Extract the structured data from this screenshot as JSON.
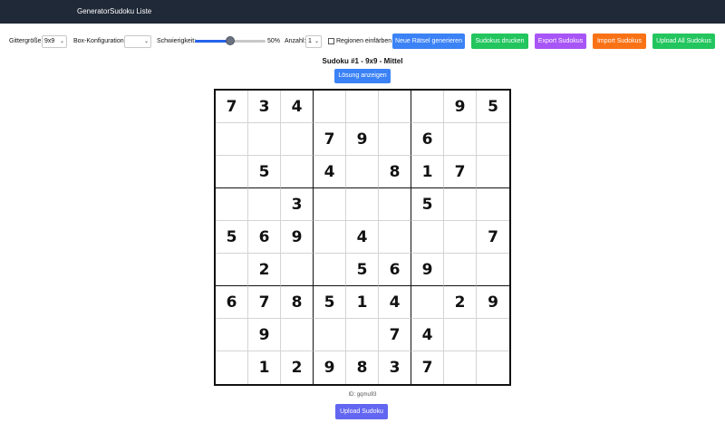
{
  "nav": {
    "items": [
      {
        "label": "Generator"
      },
      {
        "label": "Sudoku Liste"
      }
    ]
  },
  "toolbar": {
    "grid_size_label": "Gittergröße:",
    "grid_size_value": "9x9",
    "box_config_label": "Box-Konfiguration:",
    "box_config_value": "",
    "difficulty_label": "Schwierigkeit:",
    "difficulty_value": "50%",
    "difficulty_fraction": 0.5,
    "count_label": "Anzahl:",
    "count_value": "1",
    "color_regions_label": "Regionen einfärben",
    "color_regions_checked": false,
    "buttons": [
      {
        "label": "Neue Rätsel generieren",
        "color": "#3b82f6"
      },
      {
        "label": "Sudokus drucken",
        "color": "#22c55e"
      },
      {
        "label": "Export Sudokus",
        "color": "#a855f7"
      },
      {
        "label": "Import Sudokus",
        "color": "#f97316"
      },
      {
        "label": "Upload All Sudokus",
        "color": "#22c55e"
      }
    ]
  },
  "puzzle": {
    "title": "Sudoku #1 - 9x9 - Mittel",
    "show_solution_label": "Lösung anzeigen",
    "grid": [
      [
        "7",
        "3",
        "4",
        "",
        "",
        "",
        "",
        "9",
        "5"
      ],
      [
        "",
        "",
        "",
        "7",
        "9",
        "",
        "6",
        "",
        ""
      ],
      [
        "",
        "5",
        "",
        "4",
        "",
        "8",
        "1",
        "7",
        ""
      ],
      [
        "",
        "",
        "3",
        "",
        "",
        "",
        "5",
        "",
        ""
      ],
      [
        "5",
        "6",
        "9",
        "",
        "4",
        "",
        "",
        "",
        "7"
      ],
      [
        "",
        "2",
        "",
        "",
        "5",
        "6",
        "9",
        "",
        ""
      ],
      [
        "6",
        "7",
        "8",
        "5",
        "1",
        "4",
        "",
        "2",
        "9"
      ],
      [
        "",
        "9",
        "",
        "",
        "",
        "7",
        "4",
        "",
        ""
      ],
      [
        "",
        "1",
        "2",
        "9",
        "8",
        "3",
        "7",
        "",
        ""
      ]
    ],
    "id_text": "ID: gqmu93",
    "upload_label": "Upload Sudoku"
  }
}
